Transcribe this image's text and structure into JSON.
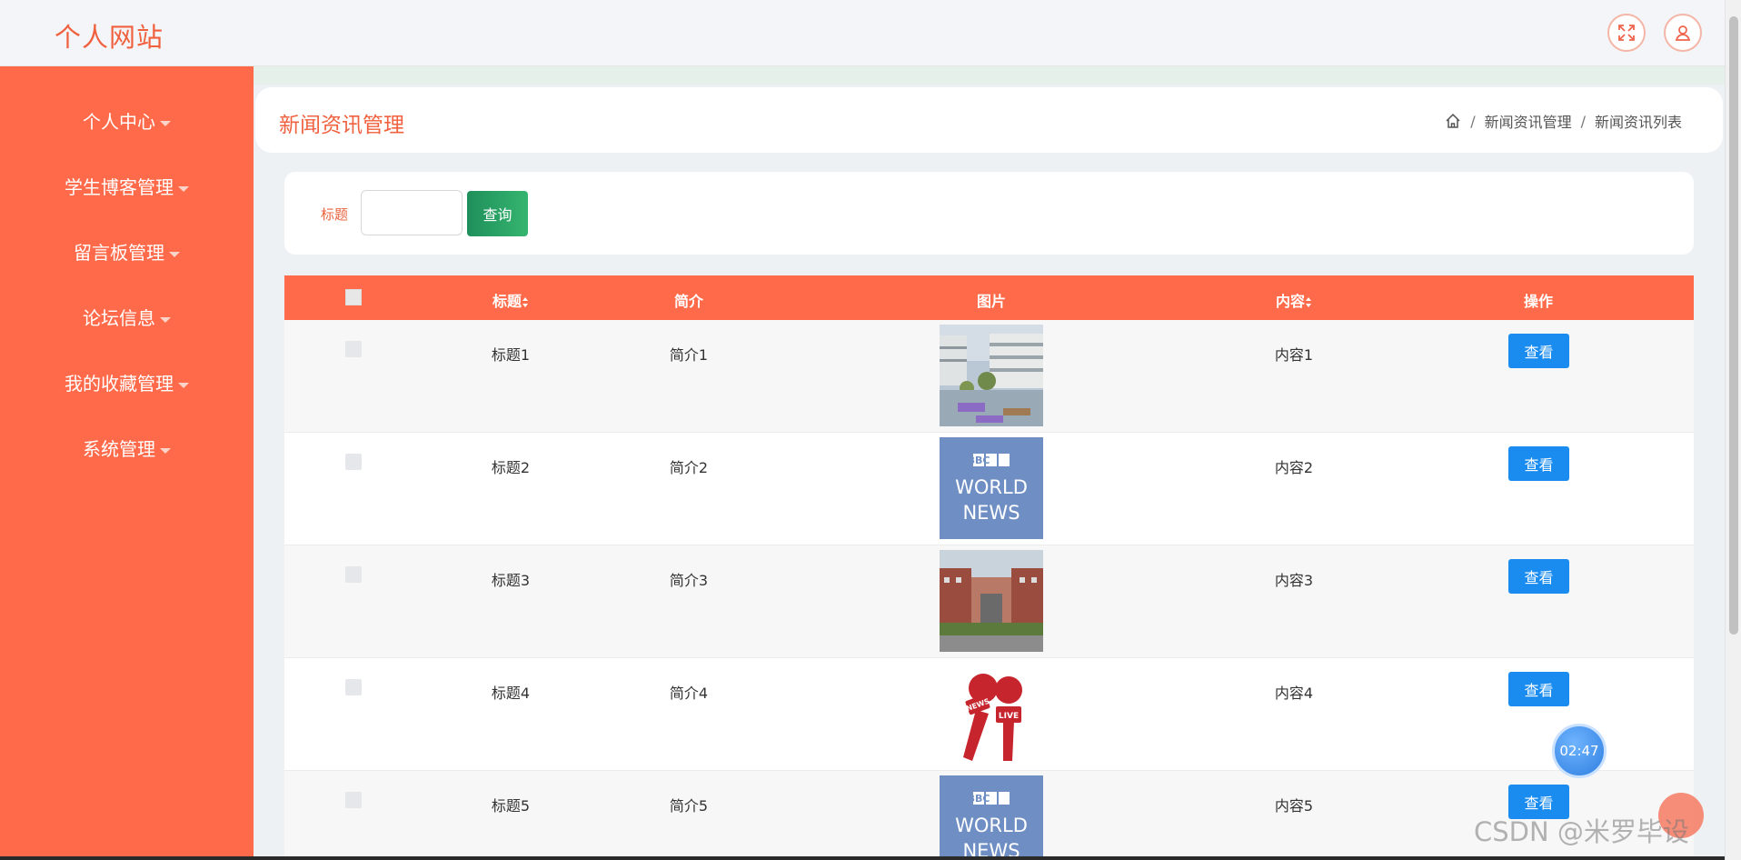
{
  "app": {
    "brand": "个人网站"
  },
  "topbar": {
    "fullscreen_icon": "fullscreen-icon",
    "user_icon": "user-icon"
  },
  "sidebar": {
    "items": [
      {
        "label": "个人中心"
      },
      {
        "label": "学生博客管理"
      },
      {
        "label": "留言板管理"
      },
      {
        "label": "论坛信息"
      },
      {
        "label": "我的收藏管理"
      },
      {
        "label": "系统管理"
      }
    ]
  },
  "header": {
    "title": "新闻资讯管理",
    "breadcrumb": [
      "新闻资讯管理",
      "新闻资讯列表"
    ],
    "separator": "/"
  },
  "search": {
    "label": "标题",
    "value": "",
    "placeholder": "",
    "button": "查询"
  },
  "table": {
    "columns": [
      "标题",
      "简介",
      "图片",
      "内容",
      "操作"
    ],
    "rows": [
      {
        "title": "标题1",
        "intro": "简介1",
        "image": "campus-building",
        "content": "内容1",
        "action": "查看"
      },
      {
        "title": "标题2",
        "intro": "简介2",
        "image": "bbc-world-news",
        "content": "内容2",
        "action": "查看"
      },
      {
        "title": "标题3",
        "intro": "简介3",
        "image": "school-gate",
        "content": "内容3",
        "action": "查看"
      },
      {
        "title": "标题4",
        "intro": "简介4",
        "image": "news-microphones",
        "content": "内容4",
        "action": "查看"
      },
      {
        "title": "标题5",
        "intro": "简介5",
        "image": "bbc-world-news",
        "content": "内容5",
        "action": "查看"
      }
    ]
  },
  "bbc_logo": {
    "line1": "BBC",
    "line2": "WORLD",
    "line3": "NEWS"
  },
  "mic_logo": {
    "news": "NEWS",
    "live": "LIVE"
  },
  "floating": {
    "timer": "02:47"
  },
  "watermark": "CSDN @米罗毕设",
  "colors": {
    "accent": "#ff6b4a",
    "brand_text": "#f0613f",
    "primary_button": "#1a8cf0",
    "search_button": "#2aa366"
  }
}
